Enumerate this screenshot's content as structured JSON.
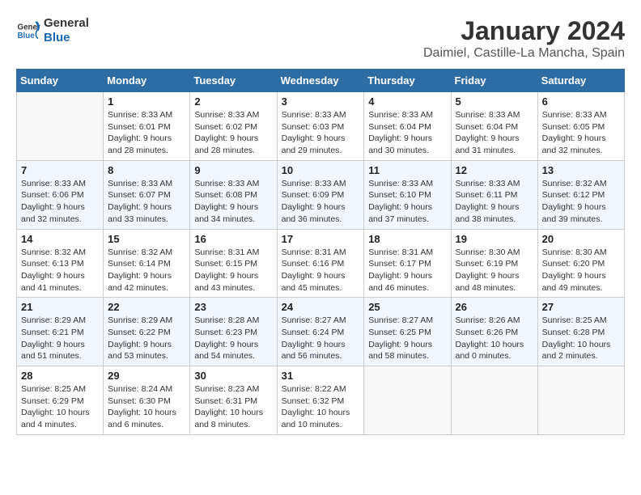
{
  "logo": {
    "line1": "General",
    "line2": "Blue"
  },
  "title": "January 2024",
  "subtitle": "Daimiel, Castille-La Mancha, Spain",
  "weekdays": [
    "Sunday",
    "Monday",
    "Tuesday",
    "Wednesday",
    "Thursday",
    "Friday",
    "Saturday"
  ],
  "weeks": [
    [
      {
        "day": "",
        "info": ""
      },
      {
        "day": "1",
        "info": "Sunrise: 8:33 AM\nSunset: 6:01 PM\nDaylight: 9 hours\nand 28 minutes."
      },
      {
        "day": "2",
        "info": "Sunrise: 8:33 AM\nSunset: 6:02 PM\nDaylight: 9 hours\nand 28 minutes."
      },
      {
        "day": "3",
        "info": "Sunrise: 8:33 AM\nSunset: 6:03 PM\nDaylight: 9 hours\nand 29 minutes."
      },
      {
        "day": "4",
        "info": "Sunrise: 8:33 AM\nSunset: 6:04 PM\nDaylight: 9 hours\nand 30 minutes."
      },
      {
        "day": "5",
        "info": "Sunrise: 8:33 AM\nSunset: 6:04 PM\nDaylight: 9 hours\nand 31 minutes."
      },
      {
        "day": "6",
        "info": "Sunrise: 8:33 AM\nSunset: 6:05 PM\nDaylight: 9 hours\nand 32 minutes."
      }
    ],
    [
      {
        "day": "7",
        "info": "Sunrise: 8:33 AM\nSunset: 6:06 PM\nDaylight: 9 hours\nand 32 minutes."
      },
      {
        "day": "8",
        "info": "Sunrise: 8:33 AM\nSunset: 6:07 PM\nDaylight: 9 hours\nand 33 minutes."
      },
      {
        "day": "9",
        "info": "Sunrise: 8:33 AM\nSunset: 6:08 PM\nDaylight: 9 hours\nand 34 minutes."
      },
      {
        "day": "10",
        "info": "Sunrise: 8:33 AM\nSunset: 6:09 PM\nDaylight: 9 hours\nand 36 minutes."
      },
      {
        "day": "11",
        "info": "Sunrise: 8:33 AM\nSunset: 6:10 PM\nDaylight: 9 hours\nand 37 minutes."
      },
      {
        "day": "12",
        "info": "Sunrise: 8:33 AM\nSunset: 6:11 PM\nDaylight: 9 hours\nand 38 minutes."
      },
      {
        "day": "13",
        "info": "Sunrise: 8:32 AM\nSunset: 6:12 PM\nDaylight: 9 hours\nand 39 minutes."
      }
    ],
    [
      {
        "day": "14",
        "info": "Sunrise: 8:32 AM\nSunset: 6:13 PM\nDaylight: 9 hours\nand 41 minutes."
      },
      {
        "day": "15",
        "info": "Sunrise: 8:32 AM\nSunset: 6:14 PM\nDaylight: 9 hours\nand 42 minutes."
      },
      {
        "day": "16",
        "info": "Sunrise: 8:31 AM\nSunset: 6:15 PM\nDaylight: 9 hours\nand 43 minutes."
      },
      {
        "day": "17",
        "info": "Sunrise: 8:31 AM\nSunset: 6:16 PM\nDaylight: 9 hours\nand 45 minutes."
      },
      {
        "day": "18",
        "info": "Sunrise: 8:31 AM\nSunset: 6:17 PM\nDaylight: 9 hours\nand 46 minutes."
      },
      {
        "day": "19",
        "info": "Sunrise: 8:30 AM\nSunset: 6:19 PM\nDaylight: 9 hours\nand 48 minutes."
      },
      {
        "day": "20",
        "info": "Sunrise: 8:30 AM\nSunset: 6:20 PM\nDaylight: 9 hours\nand 49 minutes."
      }
    ],
    [
      {
        "day": "21",
        "info": "Sunrise: 8:29 AM\nSunset: 6:21 PM\nDaylight: 9 hours\nand 51 minutes."
      },
      {
        "day": "22",
        "info": "Sunrise: 8:29 AM\nSunset: 6:22 PM\nDaylight: 9 hours\nand 53 minutes."
      },
      {
        "day": "23",
        "info": "Sunrise: 8:28 AM\nSunset: 6:23 PM\nDaylight: 9 hours\nand 54 minutes."
      },
      {
        "day": "24",
        "info": "Sunrise: 8:27 AM\nSunset: 6:24 PM\nDaylight: 9 hours\nand 56 minutes."
      },
      {
        "day": "25",
        "info": "Sunrise: 8:27 AM\nSunset: 6:25 PM\nDaylight: 9 hours\nand 58 minutes."
      },
      {
        "day": "26",
        "info": "Sunrise: 8:26 AM\nSunset: 6:26 PM\nDaylight: 10 hours\nand 0 minutes."
      },
      {
        "day": "27",
        "info": "Sunrise: 8:25 AM\nSunset: 6:28 PM\nDaylight: 10 hours\nand 2 minutes."
      }
    ],
    [
      {
        "day": "28",
        "info": "Sunrise: 8:25 AM\nSunset: 6:29 PM\nDaylight: 10 hours\nand 4 minutes."
      },
      {
        "day": "29",
        "info": "Sunrise: 8:24 AM\nSunset: 6:30 PM\nDaylight: 10 hours\nand 6 minutes."
      },
      {
        "day": "30",
        "info": "Sunrise: 8:23 AM\nSunset: 6:31 PM\nDaylight: 10 hours\nand 8 minutes."
      },
      {
        "day": "31",
        "info": "Sunrise: 8:22 AM\nSunset: 6:32 PM\nDaylight: 10 hours\nand 10 minutes."
      },
      {
        "day": "",
        "info": ""
      },
      {
        "day": "",
        "info": ""
      },
      {
        "day": "",
        "info": ""
      }
    ]
  ]
}
